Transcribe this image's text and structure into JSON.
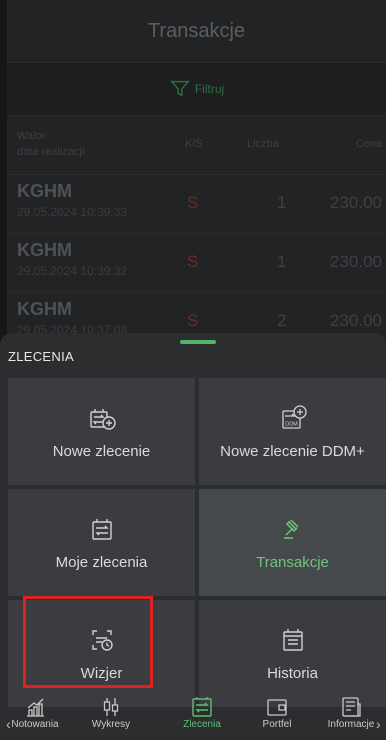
{
  "background": {
    "title": "Transakcje",
    "filter_label": "Filtruj",
    "columns": {
      "walor": "Walor",
      "data": "data realizacji",
      "ks": "K/S",
      "liczba": "Liczba",
      "cena": "Cena"
    },
    "rows": [
      {
        "symbol": "KGHM",
        "date": "29.05.2024 10:39:33",
        "side": "S",
        "qty": "1",
        "price": "230.00"
      },
      {
        "symbol": "KGHM",
        "date": "29.05.2024 10:39:32",
        "side": "S",
        "qty": "1",
        "price": "230.00"
      },
      {
        "symbol": "KGHM",
        "date": "29.05.2024 10:37:08",
        "side": "S",
        "qty": "2",
        "price": "230.00"
      }
    ]
  },
  "sheet": {
    "title": "ZLECENIA",
    "tiles": [
      {
        "label": "Nowe zlecenie",
        "icon": "new-order-icon",
        "active": false
      },
      {
        "label": "Nowe zlecenie DDM+",
        "icon": "new-order-ddm-icon",
        "icon_text": "DDM",
        "active": false
      },
      {
        "label": "Moje zlecenia",
        "icon": "my-orders-icon",
        "active": false
      },
      {
        "label": "Transakcje",
        "icon": "gavel-icon",
        "active": true
      },
      {
        "label": "Wizjer",
        "icon": "wizjer-icon",
        "active": false,
        "highlighted": true
      },
      {
        "label": "Historia",
        "icon": "history-icon",
        "active": false
      }
    ],
    "highlight_color": "#e02121",
    "accent_color": "#5fbf70"
  },
  "nav": {
    "items": [
      {
        "label": "Notowania",
        "icon": "chart-rising-icon",
        "active": false
      },
      {
        "label": "Wykresy",
        "icon": "candlestick-icon",
        "active": false
      },
      {
        "label": "Zlecenia",
        "icon": "orders-icon",
        "active": true
      },
      {
        "label": "Portfel",
        "icon": "wallet-icon",
        "active": false
      },
      {
        "label": "Informacje",
        "icon": "news-icon",
        "active": false
      }
    ],
    "left_arrow": "‹",
    "right_arrow": "›"
  }
}
